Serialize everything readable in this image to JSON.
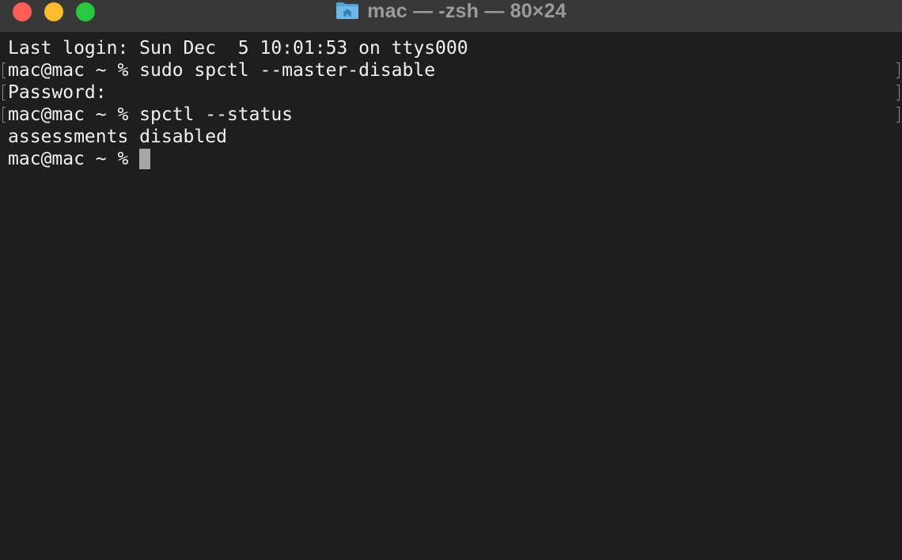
{
  "window": {
    "title": "mac — -zsh — 80×24",
    "title_icon": "home-folder-icon"
  },
  "colors": {
    "close": "#ff5f57",
    "minimize": "#febc2e",
    "zoom": "#28c840",
    "background": "#1e1e1e",
    "text": "#f2f2f2",
    "cursor": "#a6a6a6"
  },
  "terminal": {
    "lines": [
      "Last login: Sun Dec  5 10:01:53 on ttys000",
      "mac@mac ~ % sudo spctl --master-disable",
      "Password:",
      "mac@mac ~ % spctl --status",
      "assessments disabled",
      "mac@mac ~ % "
    ]
  }
}
